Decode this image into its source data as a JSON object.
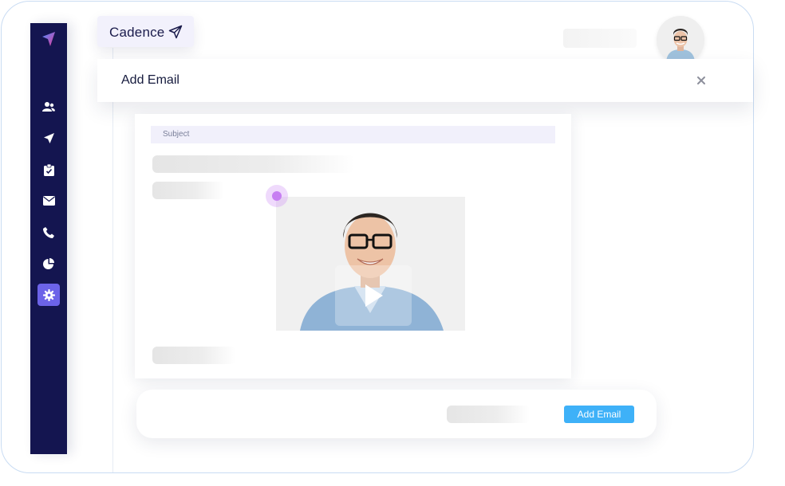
{
  "app": {
    "tab_label": "Cadence"
  },
  "modal": {
    "title": "Add Email",
    "close_glyph": "×"
  },
  "editor": {
    "subject_placeholder": "Subject"
  },
  "footer": {
    "add_button_label": "Add Email"
  },
  "sidebar": {
    "items": [
      {
        "name": "contacts",
        "icon": "users-icon"
      },
      {
        "name": "cadence",
        "icon": "paper-plane-icon"
      },
      {
        "name": "tasks",
        "icon": "clipboard-check-icon"
      },
      {
        "name": "email",
        "icon": "envelope-icon"
      },
      {
        "name": "calls",
        "icon": "phone-icon"
      },
      {
        "name": "reports",
        "icon": "pie-chart-icon"
      },
      {
        "name": "settings",
        "icon": "gear-icon",
        "active": true
      }
    ]
  },
  "colors": {
    "sidebar": "#141550",
    "accent": "#6c63e8",
    "primary_button": "#3eb1f8",
    "marker": "#c77ff2"
  }
}
